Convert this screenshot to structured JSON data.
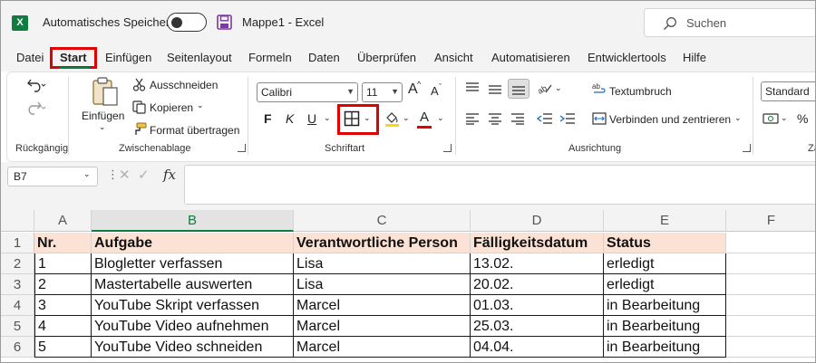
{
  "titlebar": {
    "autosave_label": "Automatisches Speichern",
    "document_title": "Mappe1 - Excel",
    "search_placeholder": "Suchen",
    "app_letter": "X"
  },
  "menu": {
    "tabs": [
      "Datei",
      "Start",
      "Einfügen",
      "Seitenlayout",
      "Formeln",
      "Daten",
      "Überprüfen",
      "Ansicht",
      "Automatisieren",
      "Entwicklertools",
      "Hilfe"
    ],
    "active_tab": "Start"
  },
  "ribbon": {
    "undo_group_label": "Rückgängig",
    "clipboard": {
      "paste_label": "Einfügen",
      "cut_label": "Ausschneiden",
      "copy_label": "Kopieren",
      "format_painter_label": "Format übertragen",
      "group_label": "Zwischenablage"
    },
    "font": {
      "font_name": "Calibri",
      "font_size": "11",
      "bold": "F",
      "italic": "K",
      "underline": "U",
      "grow": "A",
      "shrink": "A",
      "font_color_letter": "A",
      "group_label": "Schriftart"
    },
    "alignment": {
      "wrap_text_label": "Textumbruch",
      "merge_center_label": "Verbinden und zentrieren",
      "group_label": "Ausrichtung"
    },
    "number": {
      "format": "Standard",
      "percent": "%",
      "group_label_partial": "Za"
    }
  },
  "formula_bar": {
    "name_box": "B7",
    "fx_label": "fx",
    "formula": ""
  },
  "sheet": {
    "columns": [
      "A",
      "B",
      "C",
      "D",
      "E",
      "F"
    ],
    "selected_column": "B",
    "row_numbers": [
      "1",
      "2",
      "3",
      "4",
      "5",
      "6"
    ],
    "header_row": [
      "Nr.",
      "Aufgabe",
      "Verantwortliche Person",
      "Fälligkeitsdatum",
      "Status"
    ],
    "rows": [
      [
        "1",
        "Blogletter verfassen",
        "Lisa",
        "13.02.",
        "erledigt"
      ],
      [
        "2",
        "Mastertabelle auswerten",
        "Lisa",
        "20.02.",
        "erledigt"
      ],
      [
        "3",
        "YouTube Skript verfassen",
        "Marcel",
        "01.03.",
        "in Bearbeitung"
      ],
      [
        "4",
        "YouTube Video aufnehmen",
        "Marcel",
        "25.03.",
        "in Bearbeitung"
      ],
      [
        "5",
        "YouTube Video schneiden",
        "Marcel",
        "04.04.",
        "in Bearbeitung"
      ]
    ]
  },
  "colors": {
    "accent_green": "#107c41",
    "header_fill": "#fbe2d5",
    "highlight_red": "#e00000",
    "font_color_bar": "#e00000"
  }
}
